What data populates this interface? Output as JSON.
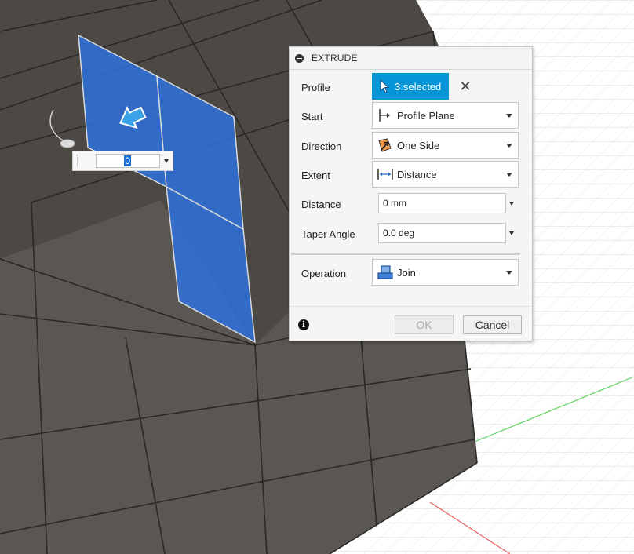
{
  "dialog": {
    "title": "EXTRUDE",
    "profile": {
      "label": "Profile",
      "selection": "3 selected",
      "clear_icon": "close-icon"
    },
    "start": {
      "label": "Start",
      "value": "Profile Plane",
      "icon": "profile-plane-icon"
    },
    "direction": {
      "label": "Direction",
      "value": "One Side",
      "icon": "one-side-direction-icon"
    },
    "extent": {
      "label": "Extent",
      "value": "Distance",
      "icon": "distance-extent-icon"
    },
    "distance": {
      "label": "Distance",
      "value": "0 mm"
    },
    "taper_angle": {
      "label": "Taper Angle",
      "value": "0.0 deg"
    },
    "operation": {
      "label": "Operation",
      "value": "Join",
      "icon": "join-operation-icon"
    },
    "buttons": {
      "ok": "OK",
      "cancel": "Cancel"
    }
  },
  "canvas_input": {
    "value": "0"
  },
  "colors": {
    "selection_blue": "#0696d7",
    "profile_face": "#2f6fd8",
    "cube_face": "#595550",
    "grid_line": "#dcdcdc"
  }
}
